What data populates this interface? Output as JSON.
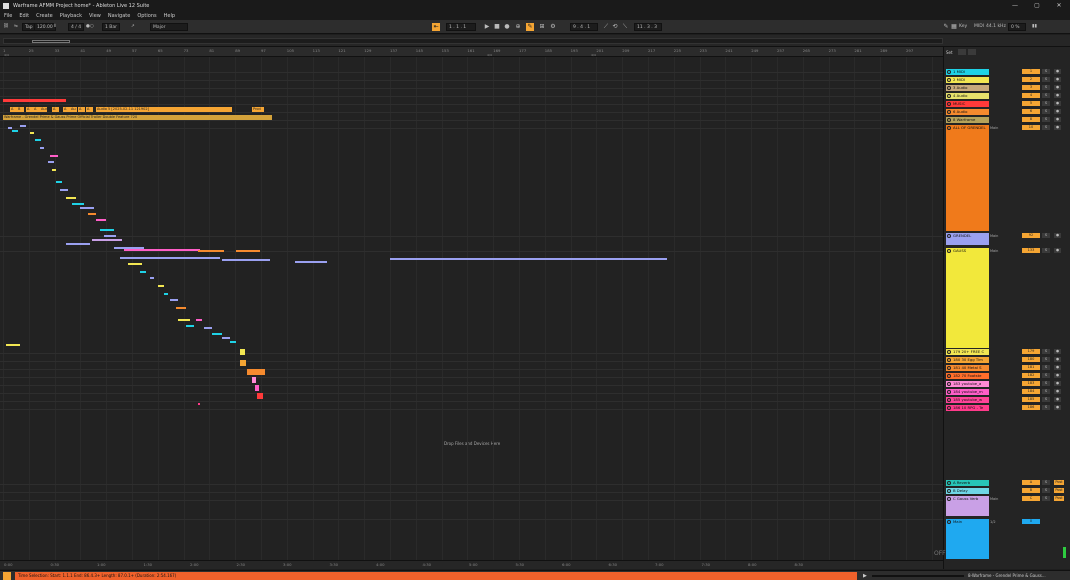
{
  "window": {
    "title": "Warframe AFMM Project home* - Ableton Live 12 Suite",
    "controls": [
      "—",
      "▢",
      "✕"
    ]
  },
  "menu": [
    "File",
    "Edit",
    "Create",
    "Playback",
    "View",
    "Navigate",
    "Options",
    "Help"
  ],
  "control_bar": {
    "tap": "Tap",
    "tempo": "120.00",
    "signature": "4 / 4",
    "metronome": "●○",
    "quantize": "1 Bar",
    "key": "Major",
    "position": "1 . 1 . 1",
    "loop_start": "9 . 4 . 1",
    "loop_length": "11 . 3 . 3",
    "key_label": "Key",
    "midi_label": "MIDI",
    "sample_rate": "44.1 kHz",
    "cpu": "0 %"
  },
  "ruler": {
    "bars": [
      "1",
      "25",
      "33",
      "41",
      "49",
      "57",
      "65",
      "73",
      "81",
      "89",
      "97",
      "105",
      "113",
      "121",
      "129",
      "137",
      "145",
      "153",
      "161",
      "169",
      "177",
      "185",
      "193",
      "201",
      "209",
      "217",
      "225",
      "233",
      "241",
      "249",
      "257",
      "265",
      "273",
      "281",
      "289",
      "297"
    ],
    "sig_left": "4/4",
    "sig_mid": "4/4"
  },
  "timeline": {
    "times": [
      "0:00",
      "0:30",
      "1:00",
      "1:30",
      "2:00",
      "2:30",
      "3:00",
      "3:30",
      "4:00",
      "4:30",
      "5:00",
      "5:30",
      "6:00",
      "6:30",
      "7:00",
      "7:30",
      "8:00",
      "8:30"
    ]
  },
  "arrangement": {
    "drop_text": "Drop Files and Devices Here",
    "clip_audio_label": "Audio 5 [2025-02-11 121902]",
    "clip_video_label": "Warframe - Grendel Prime & Gauss Prime Official Trailer Double Feature 720",
    "clip_small_labels": [
      "A",
      "B",
      "A",
      "A",
      "Audio",
      "A",
      "A",
      "Au",
      "A",
      "A",
      "Prod"
    ]
  },
  "mixer": {
    "header": [
      "Set",
      "",
      ""
    ],
    "tracks": [
      {
        "name": "1 MIDI",
        "color": "#1fd2e6",
        "vol": "1",
        "solo": "S",
        "arm": "●"
      },
      {
        "name": "2 MIDI",
        "color": "#f2e652",
        "vol": "2",
        "solo": "S",
        "arm": "●"
      },
      {
        "name": "3 Audio",
        "color": "#c8a97c",
        "vol": "3",
        "solo": "S",
        "arm": "●"
      },
      {
        "name": "4 Audio",
        "color": "#e6e06b",
        "vol": "4",
        "solo": "S",
        "arm": "●"
      },
      {
        "name": "MUSIC",
        "color": "#ff3a3a",
        "vol": "5",
        "solo": "S",
        "arm": "●"
      },
      {
        "name": "6 Audio",
        "color": "#f58a2e",
        "vol": "6",
        "solo": "S",
        "arm": "●"
      },
      {
        "name": "8 Warframe",
        "color": "#b6a35a",
        "vol": "8",
        "solo": "S",
        "arm": "●"
      },
      {
        "name": "ALL OF GRENDEL",
        "color": "#f07a1b",
        "io": "Main",
        "vol": "10",
        "solo": "S",
        "arm": "●"
      },
      {
        "name": "GRENDEL",
        "color": "#9aa0f0",
        "io": "Main",
        "vol": "92",
        "solo": "S",
        "arm": "●"
      },
      {
        "name": "GAUSS",
        "color": "#f2e83b",
        "io": "Main",
        "vol": "133",
        "solo": "S",
        "arm": "●"
      },
      {
        "name": "179 20+ FREE C",
        "color": "#f2e652",
        "vol": "179",
        "solo": "S",
        "arm": "●"
      },
      {
        "name": "180 30 Egg Tim",
        "color": "#f5a533",
        "vol": "180",
        "solo": "S",
        "arm": "●"
      },
      {
        "name": "181 40 Metal S",
        "color": "#f58a2e",
        "vol": "181",
        "solo": "S",
        "arm": "●"
      },
      {
        "name": "182 70 Footste",
        "color": "#ff6e2b",
        "vol": "182",
        "solo": "S",
        "arm": "●"
      },
      {
        "name": "183 youtube_a",
        "color": "#ff8ad6",
        "vol": "183",
        "solo": "S",
        "arm": "●"
      },
      {
        "name": "184 youtube_m",
        "color": "#ff5ec8",
        "vol": "184",
        "solo": "S",
        "arm": "●"
      },
      {
        "name": "185 youtube_w",
        "color": "#ff4499",
        "vol": "185",
        "solo": "S",
        "arm": "●"
      },
      {
        "name": "186 10 RPG - Te",
        "color": "#ff3a8a",
        "vol": "186",
        "solo": "S",
        "arm": "●"
      },
      {
        "name": "A Reverb",
        "color": "#27c4b7",
        "vol": "A",
        "solo": "S",
        "arm": "Post"
      },
      {
        "name": "B Delay",
        "color": "#6fd6e6",
        "vol": "B",
        "solo": "S",
        "arm": "Post"
      },
      {
        "name": "C Gauss Verb",
        "color": "#c9a0e6",
        "io": "Main",
        "vol": "C",
        "solo": "S",
        "arm": "Post"
      },
      {
        "name": "Main",
        "color": "#1fa9f0",
        "io": "1/2",
        "vol": "0",
        "solo": "",
        "arm": ""
      }
    ],
    "off_label": "OFF"
  },
  "status": {
    "selection": "Time Selection:  Start: 1.1.1   End: 86.4.3+   Length: 87.0.1+  (Duration: 2:54.167)",
    "right": "8-Warframe - Grendel Prime & Gauss..."
  }
}
